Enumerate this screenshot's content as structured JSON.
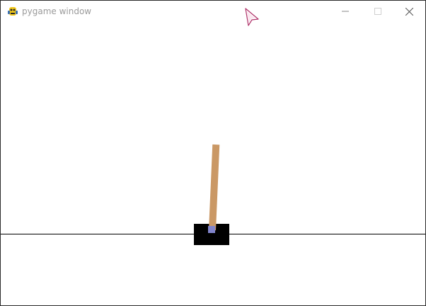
{
  "window": {
    "title": "pygame window",
    "app_icon": "pygame-snake-icon",
    "controls": {
      "minimize_icon": "minimize-icon",
      "maximize_icon": "maximize-icon",
      "close_icon": "close-icon"
    }
  },
  "scene": {
    "type": "cartpole",
    "colors": {
      "background": "#ffffff",
      "track": "#000000",
      "cart": "#000000",
      "pole": "#ca9865",
      "axle": "#8184cb"
    },
    "pole_angle_deg": 2.5
  },
  "cursor": {
    "icon": "pointer-cursor-icon"
  }
}
